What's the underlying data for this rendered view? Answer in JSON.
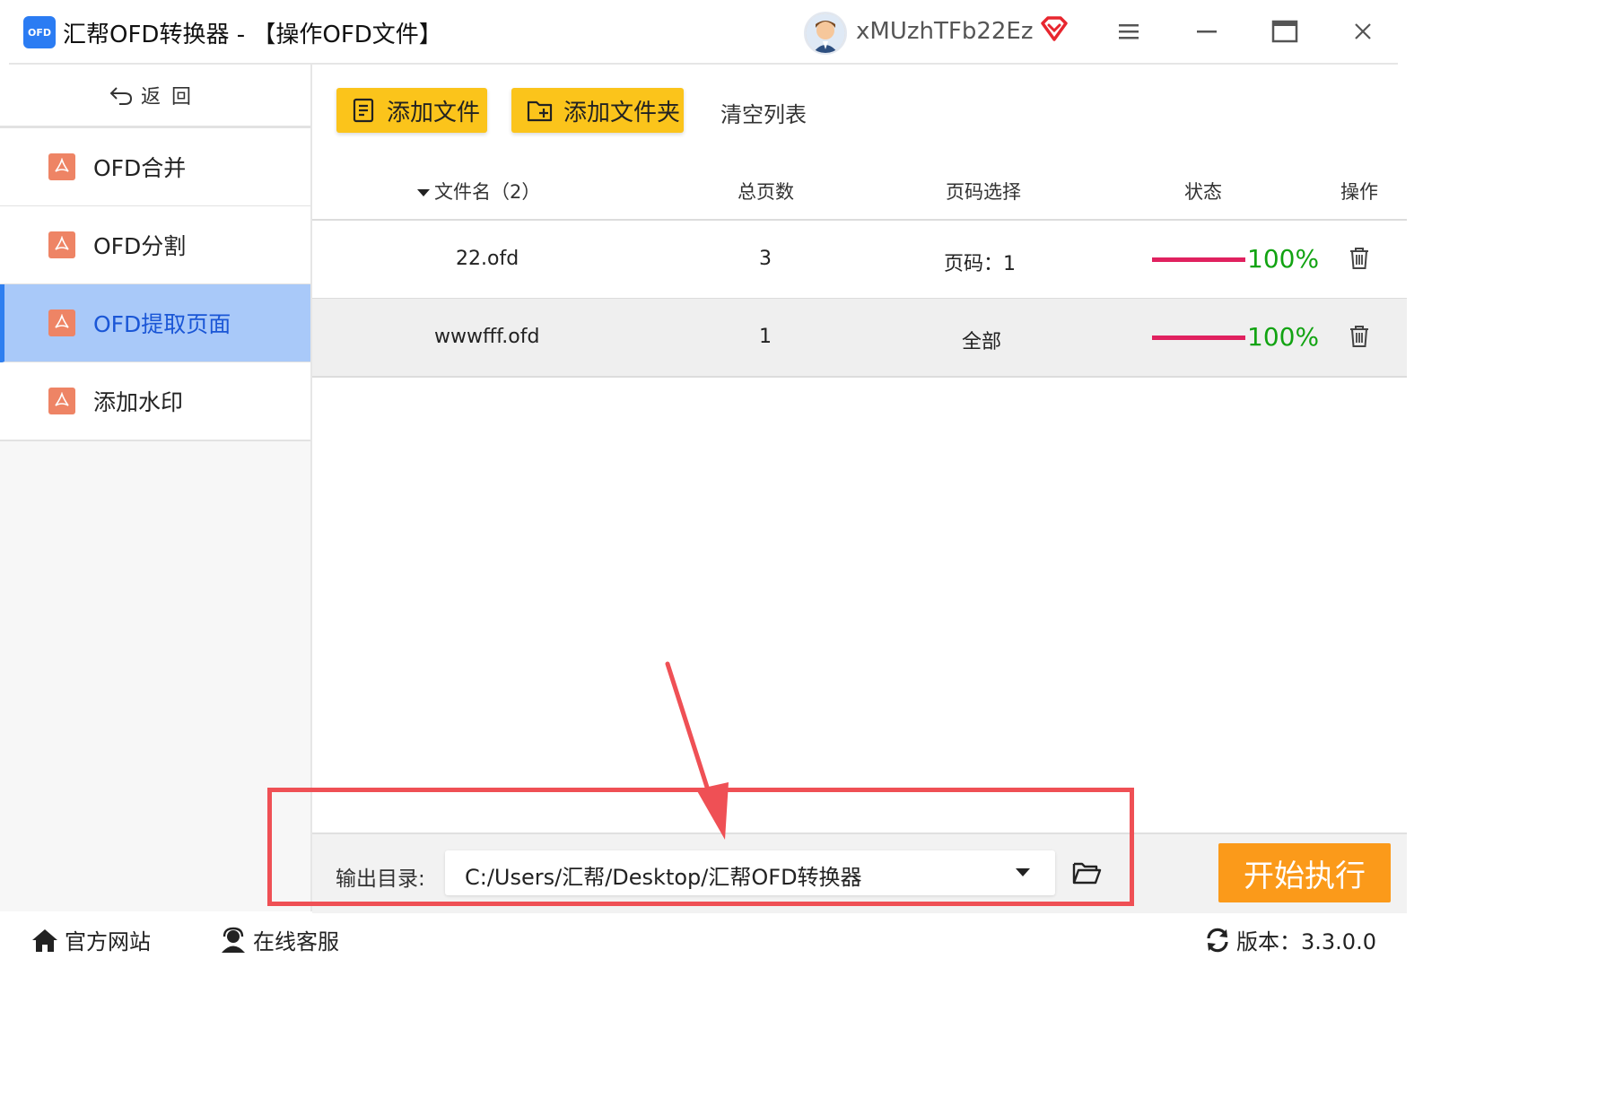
{
  "titlebar": {
    "logo_text": "OFD",
    "title": "汇帮OFD转换器 - 【操作OFD文件】",
    "username": "xMUzhTFb22Ez",
    "icons": [
      "avatar",
      "vip-icon",
      "menu-icon",
      "minimize-icon",
      "maximize-icon",
      "close-icon"
    ]
  },
  "sidebar": {
    "back_label": "返回",
    "items": [
      {
        "label": "OFD合并",
        "active": false
      },
      {
        "label": "OFD分割",
        "active": false
      },
      {
        "label": "OFD提取页面",
        "active": true
      },
      {
        "label": "添加水印",
        "active": false
      }
    ]
  },
  "toolbar": {
    "add_file": "添加文件",
    "add_folder": "添加文件夹",
    "clear_list": "清空列表"
  },
  "table": {
    "columns": [
      "文件名（2）",
      "总页数",
      "页码选择",
      "状态",
      "操作"
    ],
    "rows": [
      {
        "name": "22.ofd",
        "pages": "3",
        "selection": "页码：1",
        "progress": 1.0,
        "status": "100%"
      },
      {
        "name": "wwwfff.ofd",
        "pages": "1",
        "selection": "全部",
        "progress": 1.0,
        "status": "100%"
      }
    ]
  },
  "output": {
    "label": "输出目录:",
    "path": "C:/Users/汇帮/Desktop/汇帮OFD转换器"
  },
  "actions": {
    "start": "开始执行"
  },
  "footer": {
    "website": "官方网站",
    "support": "在线客服",
    "version": "版本：3.3.0.0"
  },
  "colors": {
    "accent_yellow": "#fbc41b",
    "start_orange": "#fb9a1a",
    "active_nav": "#a9c9f9",
    "progress": "#e0215f",
    "status_green": "#12a312",
    "annotation_red": "#ef5055"
  }
}
